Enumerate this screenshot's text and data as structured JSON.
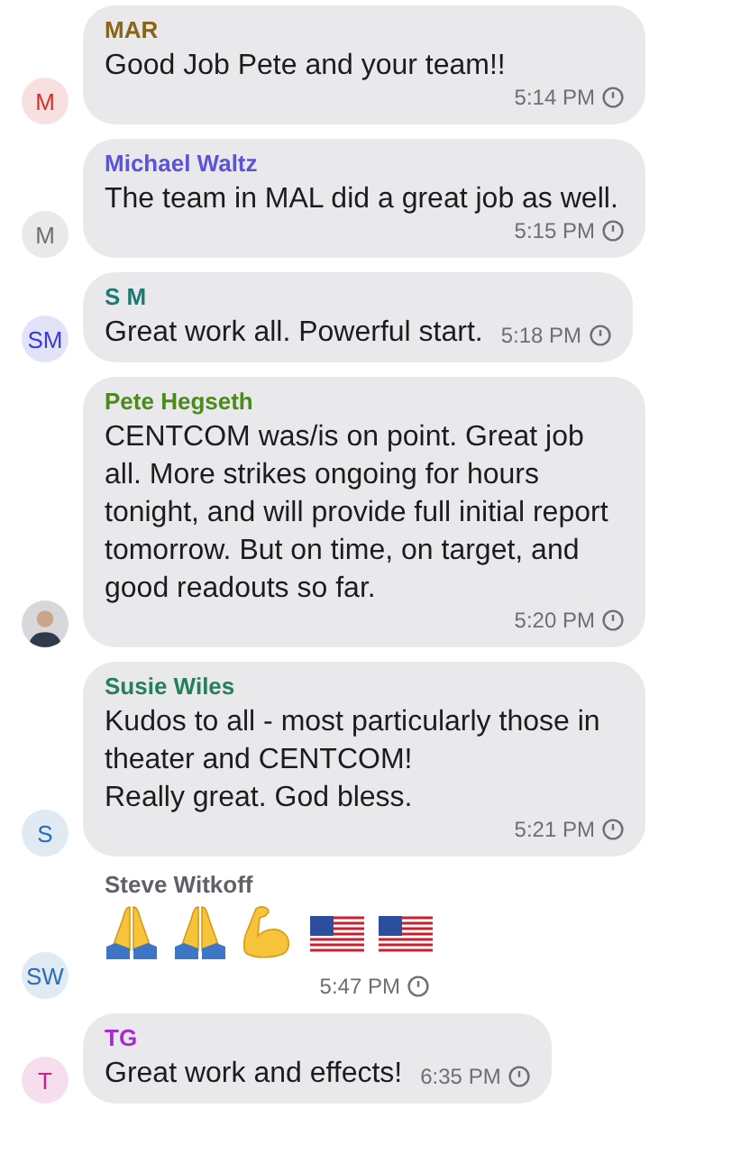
{
  "messages": [
    {
      "sender": "MAR",
      "color": "#8a6518",
      "avatar": {
        "kind": "initials",
        "initials": "M",
        "color": "#d0312d"
      },
      "kind": "text",
      "text": "Good Job Pete and your team!!",
      "time": "5:14 PM"
    },
    {
      "sender": "Michael Waltz",
      "color": "#5b55d6",
      "avatar": {
        "kind": "initials",
        "initials": "M",
        "color": "#6e6e73"
      },
      "kind": "text",
      "text": "The team in MAL did a great job  as well.",
      "time": "5:15 PM"
    },
    {
      "sender": "S M",
      "color": "#1d7a72",
      "avatar": {
        "kind": "initials",
        "initials": "SM",
        "color": "#3b3bd6"
      },
      "kind": "text",
      "text": "Great work all. Powerful start.",
      "time": "5:18 PM"
    },
    {
      "sender": "Pete Hegseth",
      "color": "#4c8a1c",
      "avatar": {
        "kind": "photo"
      },
      "kind": "text",
      "text": "CENTCOM was/is on point. Great job all. More strikes ongoing for hours tonight, and will provide full initial report tomorrow. But on time, on target, and good readouts so far.",
      "time": "5:20 PM"
    },
    {
      "sender": "Susie Wiles",
      "color": "#24805a",
      "avatar": {
        "kind": "initials",
        "initials": "S",
        "color": "#2a6fb0"
      },
      "kind": "text",
      "text": "Kudos to all - most particularly those in theater and CENTCOM!\nReally great. God bless.",
      "time": "5:21 PM"
    },
    {
      "sender": "Steve Witkoff",
      "color": "#5f6166",
      "avatar": {
        "kind": "initials",
        "initials": "SW",
        "color": "#2a6fb0"
      },
      "kind": "emoji",
      "emojis": [
        {
          "kind": "folded-hands"
        },
        {
          "kind": "folded-hands"
        },
        {
          "kind": "flexed-biceps"
        },
        {
          "kind": "flag"
        },
        {
          "kind": "flag"
        }
      ],
      "time": "5:47 PM"
    },
    {
      "sender": "TG",
      "color": "#a62bd6",
      "avatar": {
        "kind": "initials",
        "initials": "T",
        "color": "#c4218a"
      },
      "kind": "text",
      "text": "Great work and effects!",
      "time": "6:35 PM"
    }
  ]
}
